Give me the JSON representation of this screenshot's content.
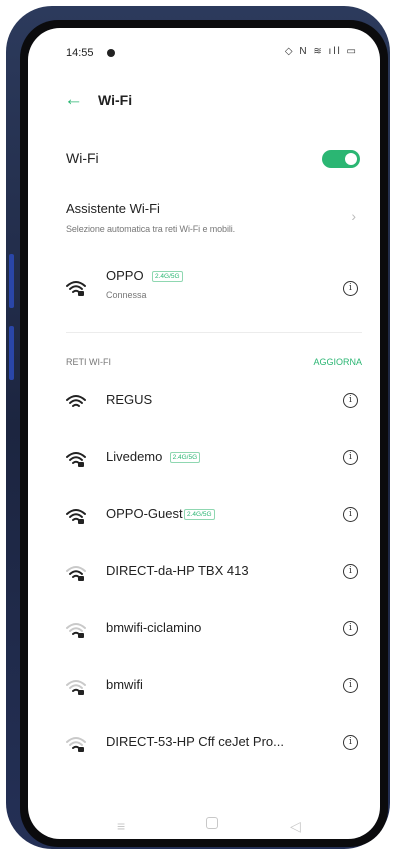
{
  "status_bar": {
    "time": "14:55",
    "icons": "◇ N ≋ ıll ▭"
  },
  "header": {
    "title": "Wi-Fi"
  },
  "wifi_toggle": {
    "label": "Wi-Fi",
    "state": "on",
    "accent": "#2bb673"
  },
  "assistant": {
    "title": "Assistente Wi-Fi",
    "subtitle": "Selezione automatica tra reti Wi-Fi e mobili."
  },
  "connected": {
    "name": "OPPO",
    "badge": "2.4G/5G",
    "status": "Connessa",
    "icon": "wifi-lock-icon"
  },
  "networks_section": {
    "label": "RETI WI-FI",
    "refresh_label": "AGGIORNA"
  },
  "networks": [
    {
      "name": "REGUS",
      "badge": "",
      "icon": "wifi-icon",
      "strength": 1.0
    },
    {
      "name": "Livedemo",
      "badge": "2.4G/5G",
      "icon": "wifi-lock-icon",
      "strength": 1.0
    },
    {
      "name": "OPPO-Guest",
      "badge": "2.4G/5G",
      "icon": "wifi-lock-icon",
      "strength": 1.0
    },
    {
      "name": "DIRECT-da-HP TBX 413",
      "badge": "",
      "icon": "wifi-lock-icon",
      "strength": 0.75
    },
    {
      "name": "bmwifi-ciclamino",
      "badge": "",
      "icon": "wifi-lock-icon",
      "strength": 0.5
    },
    {
      "name": "bmwifi",
      "badge": "",
      "icon": "wifi-lock-icon",
      "strength": 0.5
    },
    {
      "name": "DIRECT-53-HP Cff ceJet Pro...",
      "badge": "",
      "icon": "wifi-lock-icon",
      "strength": 0.5
    }
  ],
  "nav_bar": {
    "menu": "≡",
    "back": "◁"
  }
}
